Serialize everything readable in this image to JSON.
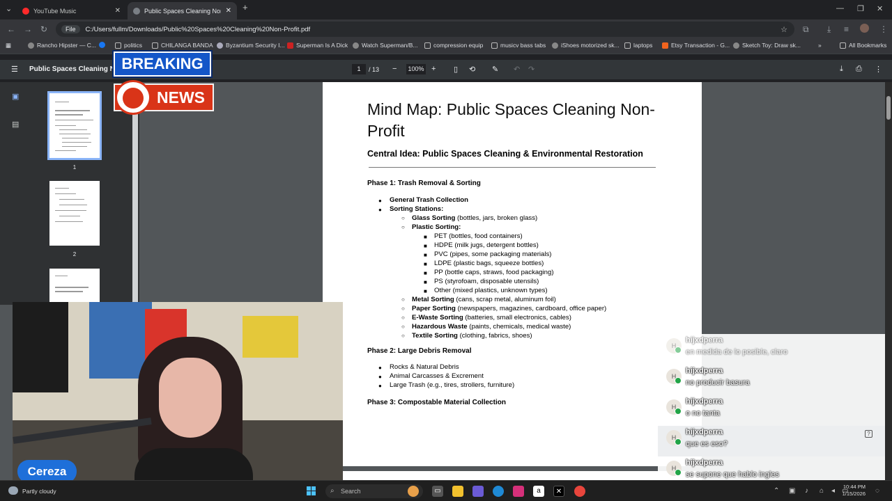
{
  "browser": {
    "tabs": [
      {
        "title": "YouTube Music",
        "active": false
      },
      {
        "title": "Public Spaces Cleaning Non-Profit",
        "active": true
      }
    ],
    "new_tab_glyph": "+",
    "address": {
      "scheme_chip": "File",
      "url": "C:/Users/fullm/Downloads/Public%20Spaces%20Cleaning%20Non-Profit.pdf"
    },
    "bookmarks": [
      "Rancho Hipster — C...",
      "politics",
      "CHILANGA BANDA",
      "Byzantium Security I...",
      "Superman Is A Dick",
      "Watch Superman/B...",
      "compression equip",
      "musicv bass tabs",
      "iShoes motorized sk...",
      "laptops",
      "Etsy Transaction - G...",
      "Sketch Toy: Draw sk..."
    ],
    "all_bookmarks": "All Bookmarks"
  },
  "pdf": {
    "title": "Public Spaces Cleaning Non-Profit",
    "page_current": "1",
    "page_total": "/ 13",
    "zoom": "100%",
    "thumbs": [
      "1",
      "2"
    ],
    "heading": "Mind Map: Public Spaces Cleaning Non-Profit",
    "central": "Central Idea: Public Spaces Cleaning & Environmental Restoration",
    "phase1": "Phase 1: Trash Removal & Sorting",
    "general": "General Trash Collection",
    "sorting": "Sorting Stations:",
    "glass_b": "Glass Sorting",
    "glass_t": " (bottles, jars, broken glass)",
    "plastic": "Plastic Sorting:",
    "plastics": [
      "PET (bottles, food containers)",
      "HDPE (milk jugs, detergent bottles)",
      "PVC (pipes, some packaging materials)",
      "LDPE (plastic bags, squeeze bottles)",
      "PP (bottle caps, straws, food packaging)",
      "PS (styrofoam, disposable utensils)",
      "Other (mixed plastics, unknown types)"
    ],
    "others": [
      {
        "b": "Metal Sorting",
        "t": " (cans, scrap metal, aluminum foil)"
      },
      {
        "b": "Paper Sorting",
        "t": " (newspapers, magazines, cardboard, office paper)"
      },
      {
        "b": "E-Waste Sorting",
        "t": " (batteries, small electronics, cables)"
      },
      {
        "b": "Hazardous Waste",
        "t": " (paints, chemicals, medical waste)"
      },
      {
        "b": "Textile Sorting",
        "t": " (clothing, fabrics, shoes)"
      }
    ],
    "phase2": "Phase 2: Large Debris Removal",
    "phase2_items": [
      "Rocks & Natural Debris",
      "Animal Carcasses & Excrement",
      "Large Trash (e.g., tires, strollers, furniture)"
    ],
    "phase3": "Phase 3: Compostable Material Collection"
  },
  "overlay": {
    "breaking": "BREAKING",
    "news": "NEWS",
    "streamer": "Cereza"
  },
  "chat": [
    {
      "user": "hijxdperra",
      "text": "en medida de lo posible, claro"
    },
    {
      "user": "hijxdperra",
      "text": "no producir basura"
    },
    {
      "user": "hijxdperra",
      "text": "o no tanta"
    },
    {
      "user": "hijxdperra",
      "text": "que es eso?"
    },
    {
      "user": "hijxdperra",
      "text": "se supone que hablo ingles"
    }
  ],
  "chat_avatar_letter": "H",
  "taskbar": {
    "weather": "Partly cloudy",
    "search": "Search",
    "time": "10:44 PM",
    "date": "1/15/2026"
  },
  "colors": {
    "accent": "#1a73e8",
    "breaking_blue": "#1456c8",
    "news_red": "#d93418",
    "cereza_blue": "#1e6fd9"
  }
}
